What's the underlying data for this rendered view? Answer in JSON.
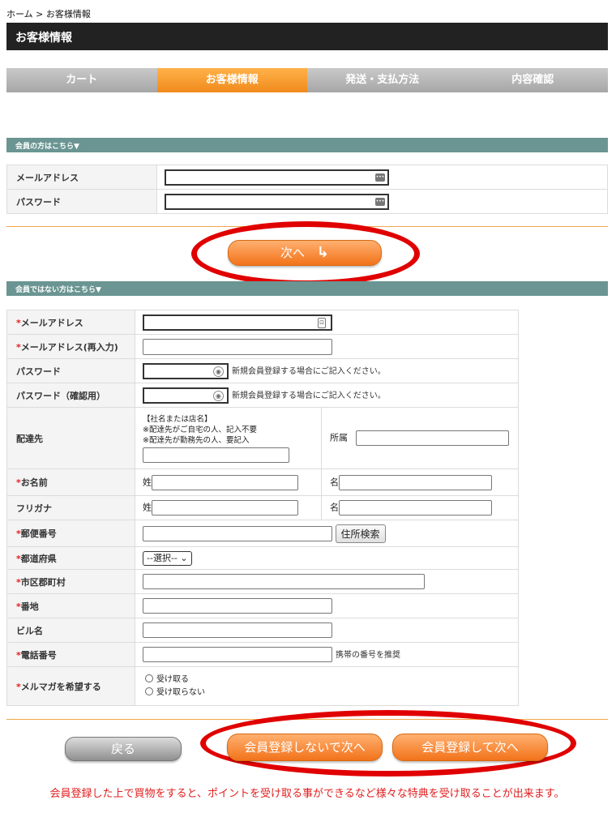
{
  "breadcrumb": "ホーム > お客様情報",
  "page_title": "お客様情報",
  "steps": [
    "カート",
    "お客様情報",
    "発送・支払方法",
    "内容確認"
  ],
  "member_section": {
    "header": "会員の方はこちら▼",
    "email_label": "メールアドレス",
    "password_label": "パスワード",
    "next_label": "次へ"
  },
  "guest_section": {
    "header": "会員ではない方はこちら▼",
    "required_mark": "*",
    "email_label": "メールアドレス",
    "email_confirm_label": "メールアドレス(再入力)",
    "password_label": "パスワード",
    "password_confirm_label": "パスワード（確認用）",
    "password_hint": "新規会員登録する場合にご記入ください。",
    "delivery_label": "配達先",
    "delivery_note_1": "【社名または店名】",
    "delivery_note_2": "※配達先がご自宅の人、記入不要",
    "delivery_note_3": "※配達先が勤務先の人、要記入",
    "affiliation_label": "所属",
    "name_label": "お名前",
    "furigana_label": "フリガナ",
    "last_name_label": "姓",
    "first_name_label": "名",
    "zip_label": "郵便番号",
    "address_search_label": "住所検索",
    "prefecture_label": "都道府県",
    "prefecture_value": "--選択--",
    "city_label": "市区郡町村",
    "street_label": "番地",
    "building_label": "ビル名",
    "phone_label": "電話番号",
    "phone_hint": "携帯の番号を推奨",
    "newsletter_label": "メルマガを希望する",
    "newsletter_options": [
      "受け取る",
      "受け取らない"
    ]
  },
  "buttons": {
    "back": "戻る",
    "guest_next": "会員登録しないで次へ",
    "register_next": "会員登録して次へ"
  },
  "bottom_note": "会員登録した上で買物をすると、ポイントを受け取る事ができるなど様々な特典を受け取ることが出来ます。",
  "colors": {
    "accent_orange": "#f08a1c",
    "section_teal": "#6a9592",
    "highlight_red": "#e00000",
    "required_red": "#e02020"
  }
}
